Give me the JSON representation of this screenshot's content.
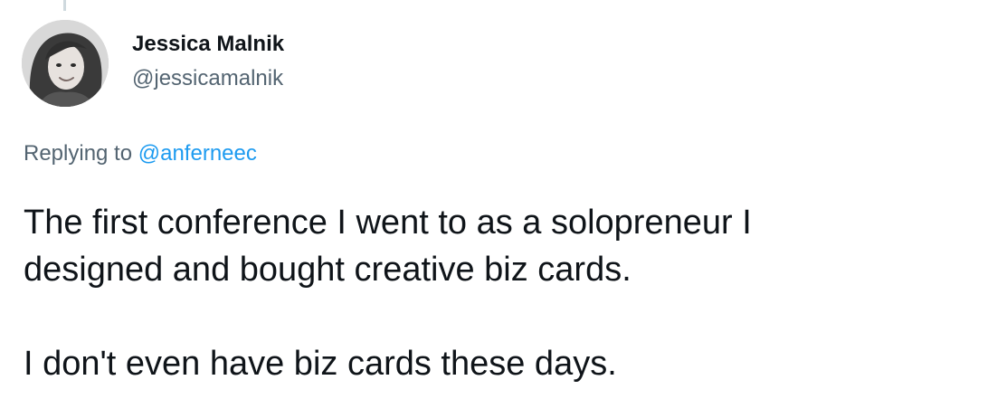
{
  "author": {
    "display_name": "Jessica Malnik",
    "handle": "@jessicamalnik",
    "avatar": "profile-photo"
  },
  "reply": {
    "prefix": "Replying to",
    "mention": "@anferneec"
  },
  "tweet": {
    "lines": [
      "The first conference I went to as a solopreneur I",
      "designed and bought creative biz cards.",
      "",
      "I don't even have biz cards these days."
    ]
  },
  "colors": {
    "text": "#0f1419",
    "secondary": "#536471",
    "link": "#1d9bf0",
    "thread_line": "#cfd9de"
  }
}
